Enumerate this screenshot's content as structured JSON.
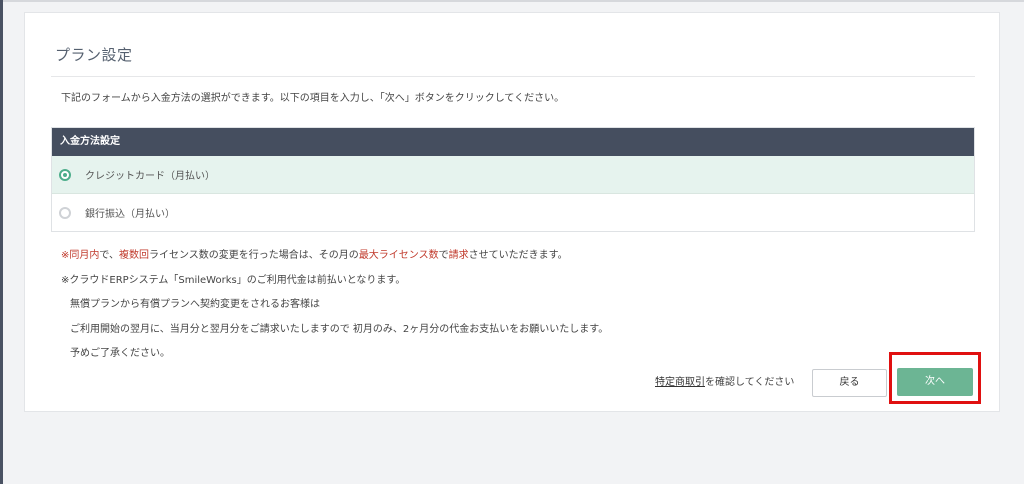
{
  "page": {
    "title": "プラン設定",
    "intro": "下記のフォームから入金方法の選択ができます。以下の項目を入力し、「次へ」ボタンをクリックしてください。"
  },
  "payment": {
    "header": "入金方法設定",
    "options": [
      {
        "label": "クレジットカード（月払い）",
        "selected": true
      },
      {
        "label": "銀行振込（月払い）",
        "selected": false
      }
    ]
  },
  "notes": {
    "line1": {
      "p1": "※",
      "p2": "同月内",
      "p3": "で、",
      "p4": "複数回",
      "p5": "ライセンス数の変更を行った場合は、その月の",
      "p6": "最大ライセンス数",
      "p7": "で",
      "p8": "請求",
      "p9": "させていただきます。"
    },
    "line2": "※クラウドERPシステム「SmileWorks」のご利用代金は前払いとなります。",
    "line3": "無償プランから有償プランへ契約変更をされるお客様は",
    "line4": "ご利用開始の翌月に、当月分と翌月分をご請求いたしますので 初月のみ、2ヶ月分の代金お支払いをお願いいたします。",
    "line5": "予めご了承ください。"
  },
  "footer": {
    "link_text": "特定商取引",
    "link_suffix": "を確認してください",
    "back_label": "戻る",
    "next_label": "次へ"
  },
  "colors": {
    "header_bg": "#454e5f",
    "selected_row_bg": "#e6f3ee",
    "accent_green": "#6cb594",
    "highlight_red": "#e01010",
    "note_red": "#c0392b"
  }
}
